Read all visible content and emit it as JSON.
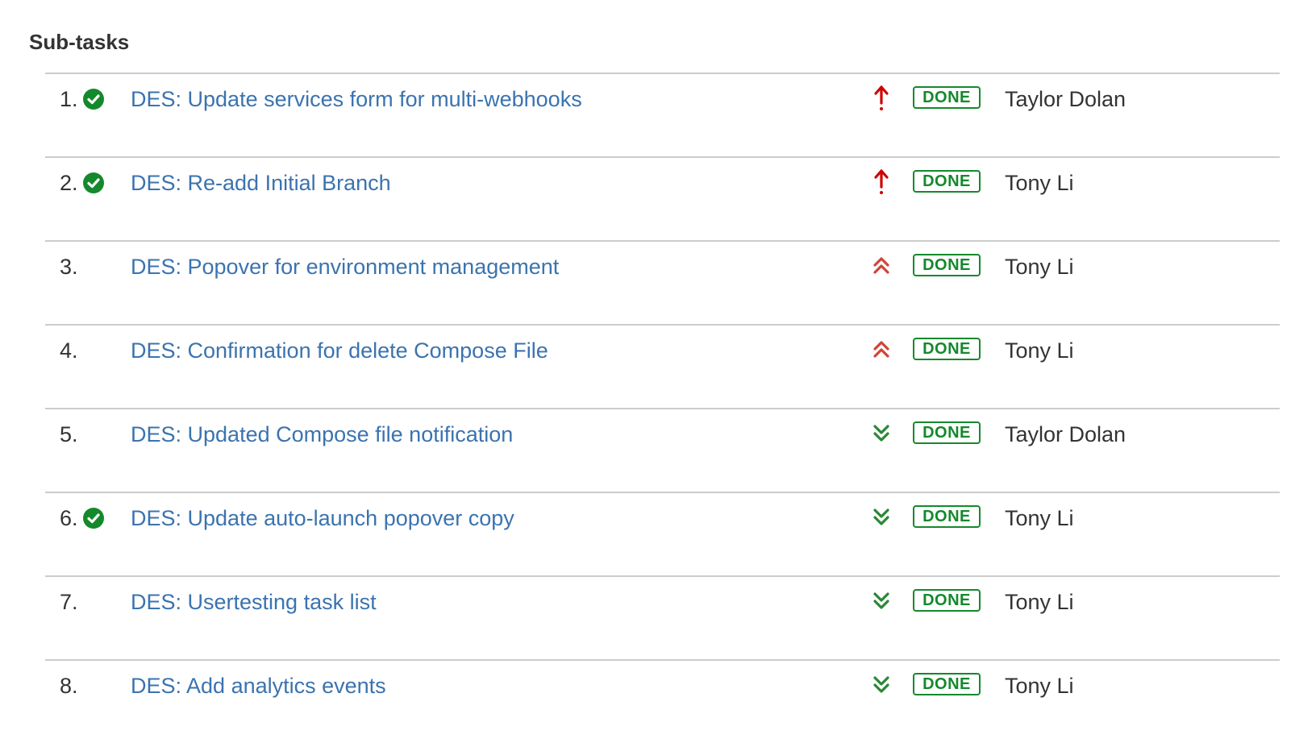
{
  "section": {
    "title": "Sub-tasks"
  },
  "colors": {
    "link": "#3b73af",
    "done_green": "#14892c",
    "priority_high": "#d04437",
    "priority_highest": "#ce0000",
    "priority_low": "#2a8735",
    "resolved_check": "#14892c"
  },
  "subtasks": [
    {
      "number": "1.",
      "resolved": true,
      "summary": "DES: Update services form for multi-webhooks",
      "priority_icon": "priority-highest-arrow-icon",
      "status": "DONE",
      "assignee": "Taylor Dolan"
    },
    {
      "number": "2.",
      "resolved": true,
      "summary": "DES: Re-add Initial Branch",
      "priority_icon": "priority-highest-arrow-icon",
      "status": "DONE",
      "assignee": "Tony Li"
    },
    {
      "number": "3.",
      "resolved": false,
      "summary": "DES: Popover for environment management",
      "priority_icon": "priority-high-double-chevron-up-icon",
      "status": "DONE",
      "assignee": "Tony Li"
    },
    {
      "number": "4.",
      "resolved": false,
      "summary": "DES: Confirmation for delete Compose File",
      "priority_icon": "priority-high-double-chevron-up-icon",
      "status": "DONE",
      "assignee": "Tony Li"
    },
    {
      "number": "5.",
      "resolved": false,
      "summary": "DES: Updated Compose file notification",
      "priority_icon": "priority-low-double-chevron-down-icon",
      "status": "DONE",
      "assignee": "Taylor Dolan"
    },
    {
      "number": "6.",
      "resolved": true,
      "summary": "DES: Update auto-launch popover copy",
      "priority_icon": "priority-low-double-chevron-down-icon",
      "status": "DONE",
      "assignee": "Tony Li"
    },
    {
      "number": "7.",
      "resolved": false,
      "summary": "DES: Usertesting task list",
      "priority_icon": "priority-low-double-chevron-down-icon",
      "status": "DONE",
      "assignee": "Tony Li"
    },
    {
      "number": "8.",
      "resolved": false,
      "summary": "DES: Add analytics events",
      "priority_icon": "priority-low-double-chevron-down-icon",
      "status": "DONE",
      "assignee": "Tony Li"
    }
  ]
}
